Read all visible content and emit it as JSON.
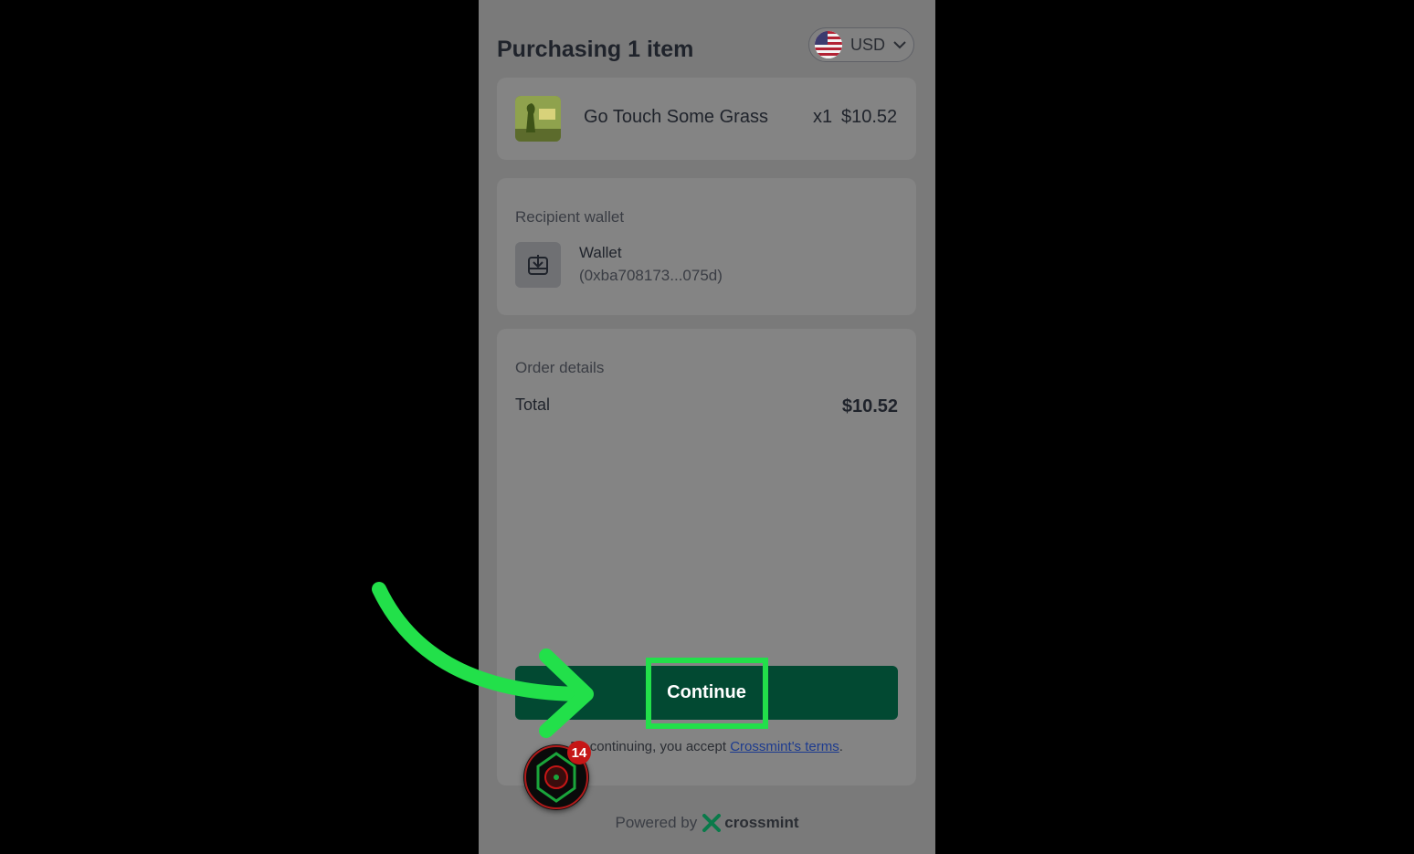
{
  "header": {
    "title": "Purchasing 1 item",
    "currency": "USD",
    "currency_flag_icon": "us-flag-icon"
  },
  "item": {
    "name": "Go Touch Some Grass",
    "quantity": "x1",
    "price": "$10.52"
  },
  "recipient": {
    "label": "Recipient wallet",
    "wallet_name": "Wallet",
    "wallet_address": "(0xba708173...075d)"
  },
  "order": {
    "label": "Order details",
    "total_label": "Total",
    "total_value": "$10.52"
  },
  "actions": {
    "continue_label": "Continue"
  },
  "terms": {
    "prefix": "By continuing, you accept ",
    "link": "Crossmint's terms",
    "suffix": "."
  },
  "footer": {
    "powered_by": "Powered by",
    "brand": "crossmint"
  },
  "notification": {
    "count": "14"
  },
  "colors": {
    "accent_green": "#22e04a",
    "button_green": "#024932"
  }
}
